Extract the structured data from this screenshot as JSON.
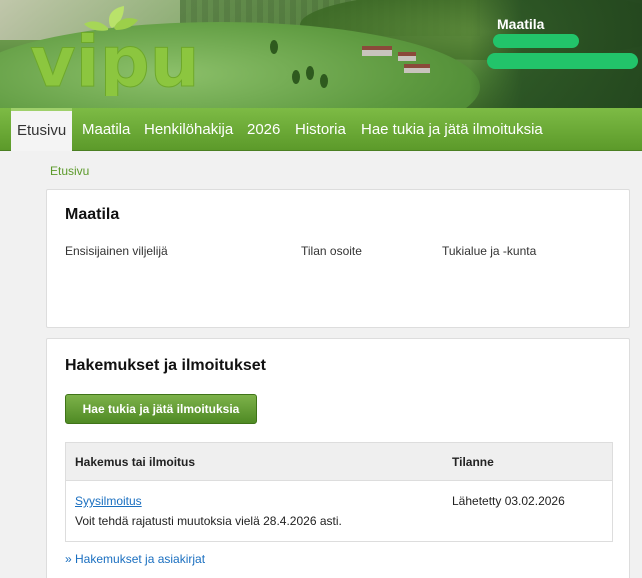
{
  "header": {
    "logo_text": "vipu",
    "farm_title": "Maatila"
  },
  "nav": {
    "items": [
      {
        "label": "Etusivu",
        "active": true
      },
      {
        "label": "Maatila"
      },
      {
        "label": "Henkilöhakija"
      },
      {
        "label": "2026"
      },
      {
        "label": "Historia"
      },
      {
        "label": "Hae tukia ja jätä ilmoituksia"
      }
    ]
  },
  "breadcrumb": "Etusivu",
  "farm_card": {
    "title": "Maatila",
    "fields": [
      "Ensisijainen viljelijä",
      "Tilan osoite",
      "Tukialue ja -kunta"
    ]
  },
  "applications": {
    "title": "Hakemukset ja ilmoitukset",
    "button_label": "Hae tukia ja jätä ilmoituksia",
    "table": {
      "headers": [
        "Hakemus tai ilmoitus",
        "Tilanne"
      ],
      "rows": [
        {
          "name": "Syysilmoitus",
          "note": "Voit tehdä rajatusti muutoksia vielä 28.4.2026 asti.",
          "status": "Lähetetty 03.02.2026"
        }
      ]
    },
    "more_link": "» Hakemukset ja asiakirjat"
  },
  "colors": {
    "accent_green": "#5c9a2a",
    "link_blue": "#1a6fc0",
    "redaction_green": "#22c46a"
  }
}
